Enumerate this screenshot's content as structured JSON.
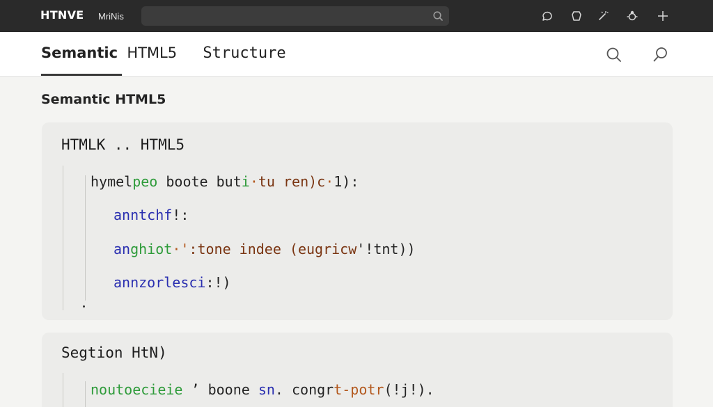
{
  "topbar": {
    "logo": "HTNVE",
    "app_name": "MriNis",
    "search": {
      "value": "",
      "placeholder": ""
    },
    "icons": [
      "chat-bubble-icon",
      "shield-icon",
      "magic-wand-icon",
      "bug-icon",
      "plus-icon"
    ]
  },
  "header": {
    "title_part1": "Semantic",
    "title_part2": "HTML5",
    "title_part3": "Structure",
    "icons": [
      "search-icon",
      "magnifier-icon"
    ]
  },
  "main": {
    "section_title": "Semantic HTML5",
    "card1": {
      "title": "HTMLK ..  HTML5",
      "lines": [
        {
          "segments": [
            "hymel",
            "peo",
            "  boote  but",
            "i",
            "·",
            "tu  ren)c",
            "·",
            "1):"
          ]
        },
        {
          "segments": [
            "anntchf",
            "!:"
          ]
        },
        {
          "segments": [
            "an",
            "ghiot",
            "·'",
            ":tone  indee  (",
            "eugricw",
            "'!tnt))"
          ]
        },
        {
          "segments": [
            "annzorlesci",
            ":!)"
          ]
        }
      ]
    },
    "card2": {
      "title": "Segtion  HtN)",
      "lines": [
        {
          "segments": [
            "noutoecieie",
            " ’  boone  ",
            "sn",
            ".  congr",
            "t-potr",
            "(!j!)."
          ]
        }
      ]
    }
  }
}
